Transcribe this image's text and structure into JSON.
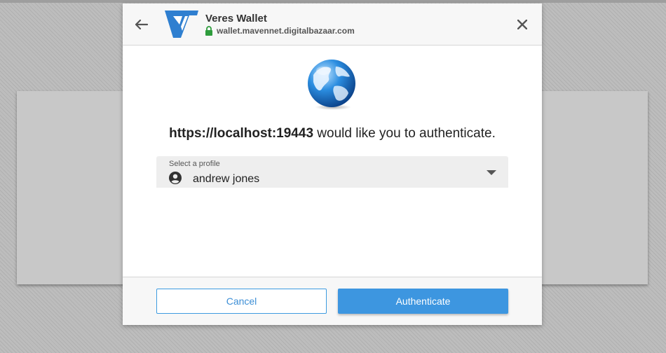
{
  "header": {
    "app_title": "Veres Wallet",
    "origin_url": "wallet.mavennet.digitalbazaar.com",
    "back_icon": "arrow-left-icon",
    "close_icon": "close-icon",
    "logo_icon": "veres-logo-icon",
    "lock_icon": "lock-icon"
  },
  "main": {
    "globe_icon": "globe-icon",
    "requesting_origin": "https://localhost:19443",
    "message_text": " would like you to authenticate.",
    "profile_select": {
      "label": "Select a profile",
      "value": "andrew jones",
      "account_icon": "account-circle-icon",
      "caret_icon": "caret-down-icon"
    }
  },
  "footer": {
    "cancel_label": "Cancel",
    "authenticate_label": "Authenticate"
  },
  "colors": {
    "accent": "#3d96e0",
    "lock_green": "#2e9c3c",
    "logo_blue": "#2f7fd0"
  }
}
